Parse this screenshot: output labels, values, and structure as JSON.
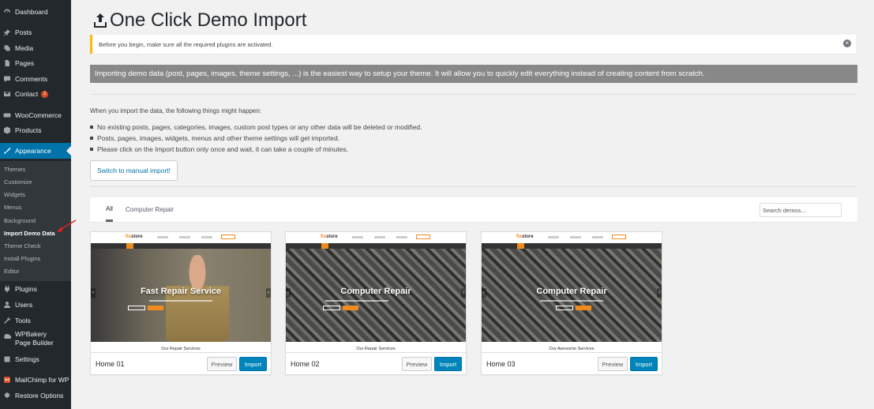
{
  "sidebar": {
    "top_items": [
      {
        "label": "Dashboard",
        "icon": "dashboard-icon"
      },
      {
        "label": "Posts",
        "icon": "pin-icon"
      },
      {
        "label": "Media",
        "icon": "media-icon"
      },
      {
        "label": "Pages",
        "icon": "pages-icon"
      },
      {
        "label": "Comments",
        "icon": "comments-icon"
      },
      {
        "label": "Contact",
        "icon": "mail-icon",
        "badge": "1"
      },
      {
        "label": "WooCommerce",
        "icon": "woocommerce-icon"
      },
      {
        "label": "Products",
        "icon": "products-icon"
      },
      {
        "label": "Appearance",
        "icon": "paintbrush-icon"
      }
    ],
    "appearance_submenu": [
      "Themes",
      "Customize",
      "Widgets",
      "Menus",
      "Background",
      "Import Demo Data",
      "Theme Check",
      "Install Plugins",
      "Editor"
    ],
    "bottom_items": [
      {
        "label": "Plugins",
        "icon": "plugins-icon"
      },
      {
        "label": "Users",
        "icon": "users-icon"
      },
      {
        "label": "Tools",
        "icon": "tools-icon"
      },
      {
        "label": "WPBakery Page Builder",
        "icon": "wpbakery-icon"
      },
      {
        "label": "Settings",
        "icon": "settings-icon"
      },
      {
        "label": "MailChimp for WP",
        "icon": "mailchimp-icon"
      },
      {
        "label": "Restore Options",
        "icon": "restore-icon"
      }
    ]
  },
  "page": {
    "title": "One Click Demo Import",
    "notice": "Before you begin, make sure all the required plugins are activated.",
    "intro": "Importing demo data (post, pages, images, theme settings, ...) is the easiest way to setup your theme. It will allow you to quickly edit everything instead of creating content from scratch.",
    "what_happens": "When you import the data, the following things might happen:",
    "bullets": [
      "No existing posts, pages, categories, images, custom post types or any other data will be deleted or modified.",
      "Posts, pages, images, widgets, menus and other theme settings will get imported.",
      "Please click on the Import button only once and wait, it can take a couple of minutes."
    ],
    "manual_import_label": "Switch to manual import!"
  },
  "filter": {
    "tabs": [
      "All",
      "Computer Repair"
    ],
    "search_placeholder": "Search demos..."
  },
  "demos": [
    {
      "name": "Home 01",
      "hero_title": "Fast Repair Service",
      "section_title": "Our Repair Services"
    },
    {
      "name": "Home 02",
      "hero_title": "Computer Repair",
      "section_title": "Our Repair Services"
    },
    {
      "name": "Home 03",
      "hero_title": "Computer Repair",
      "section_title": "Our Awesome Services"
    }
  ],
  "demo_thumb_logo": {
    "accent": "fix",
    "rest": "store"
  },
  "buttons": {
    "preview": "Preview",
    "import": "Import"
  },
  "colors": {
    "sidebar": "#23282d",
    "active": "#0073aa",
    "notice_border": "#ffb900",
    "import_button": "#0085ba",
    "accent_orange": "#f08b1d"
  }
}
